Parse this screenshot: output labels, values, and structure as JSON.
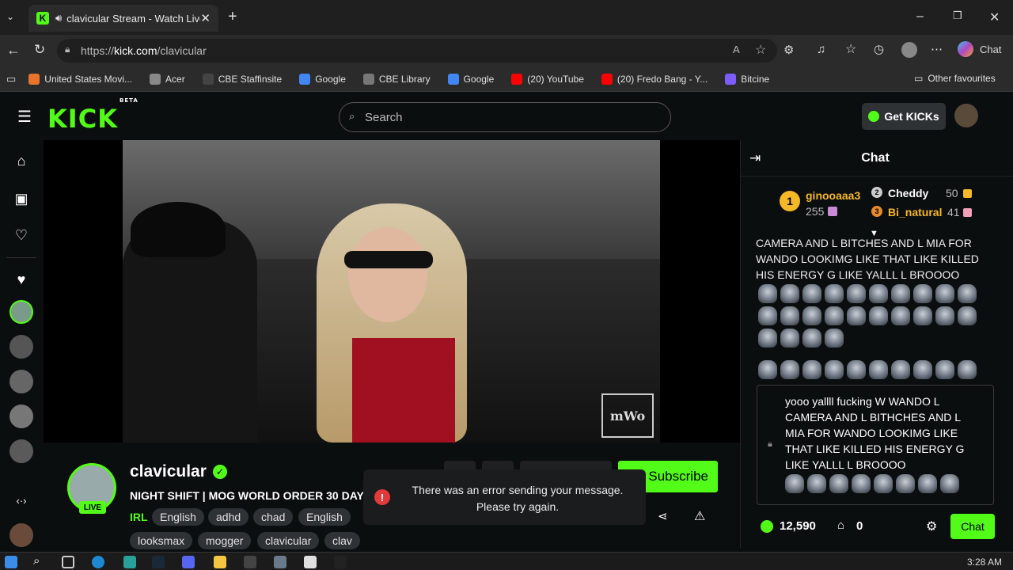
{
  "browser": {
    "tab_title": "clavicular Stream - Watch Live",
    "url_prefix": "https://",
    "url_domain": "kick.com",
    "url_path": "/clavicular",
    "chat_label": "Chat",
    "bookmarks": [
      {
        "label": "United States Movi...",
        "color": "#e8742c"
      },
      {
        "label": "Acer",
        "color": "#888"
      },
      {
        "label": "CBE Staffinsite",
        "color": "#444"
      },
      {
        "label": "Google",
        "color": "#4285f4"
      },
      {
        "label": "CBE Library",
        "color": "#777"
      },
      {
        "label": "Google",
        "color": "#4285f4"
      },
      {
        "label": "(20) YouTube",
        "color": "#ff0000"
      },
      {
        "label": "(20) Fredo Bang - Y...",
        "color": "#ff0000"
      },
      {
        "label": "Bitcine",
        "color": "#7b5cff"
      }
    ],
    "other_favourites": "Other favourites"
  },
  "kick": {
    "logo": "KICK",
    "logo_sup": "BETA",
    "search_placeholder": "Search",
    "get_kicks": "Get KICKs"
  },
  "channel": {
    "name": "clavicular",
    "live": "LIVE",
    "title": "NIGHT SHIFT | MOG WORLD ORDER 30 DAY",
    "category": "IRL",
    "tags": [
      "English",
      "adhd",
      "chad",
      "English",
      "looksmax",
      "mogger",
      "clavicular",
      "clav"
    ],
    "subscribe": "Subscribe"
  },
  "error": {
    "line1": "There was an error sending your message.",
    "line2": "Please try again."
  },
  "chat": {
    "title": "Chat",
    "leaderboard": [
      {
        "rank": "1",
        "name": "ginooaaa3",
        "value": "255",
        "color": "#f5b826"
      },
      {
        "rank": "2",
        "name": "Cheddy",
        "value": "50",
        "color": "#ffffff"
      },
      {
        "rank": "3",
        "name": "Bi_natural",
        "value": "41",
        "color": "#f5b826"
      }
    ],
    "message": "CAMERA AND L BITCHES AND L MIA FOR WANDO LOOKIMG LIKE THAT LIKE KILLED HIS ENERGY G LIKE YALLL L BROOOO",
    "input_text": "yooo yallll fucking W WANDO L CAMERA AND L BITHCHES AND L MIA FOR WANDO LOOKIMG LIKE THAT LIKE KILLED HIS ENERGY G LIKE YALLL L BROOOO",
    "points": "12,590",
    "kicks": "0",
    "send": "Chat"
  },
  "taskbar": {
    "time": "3:28 AM"
  }
}
